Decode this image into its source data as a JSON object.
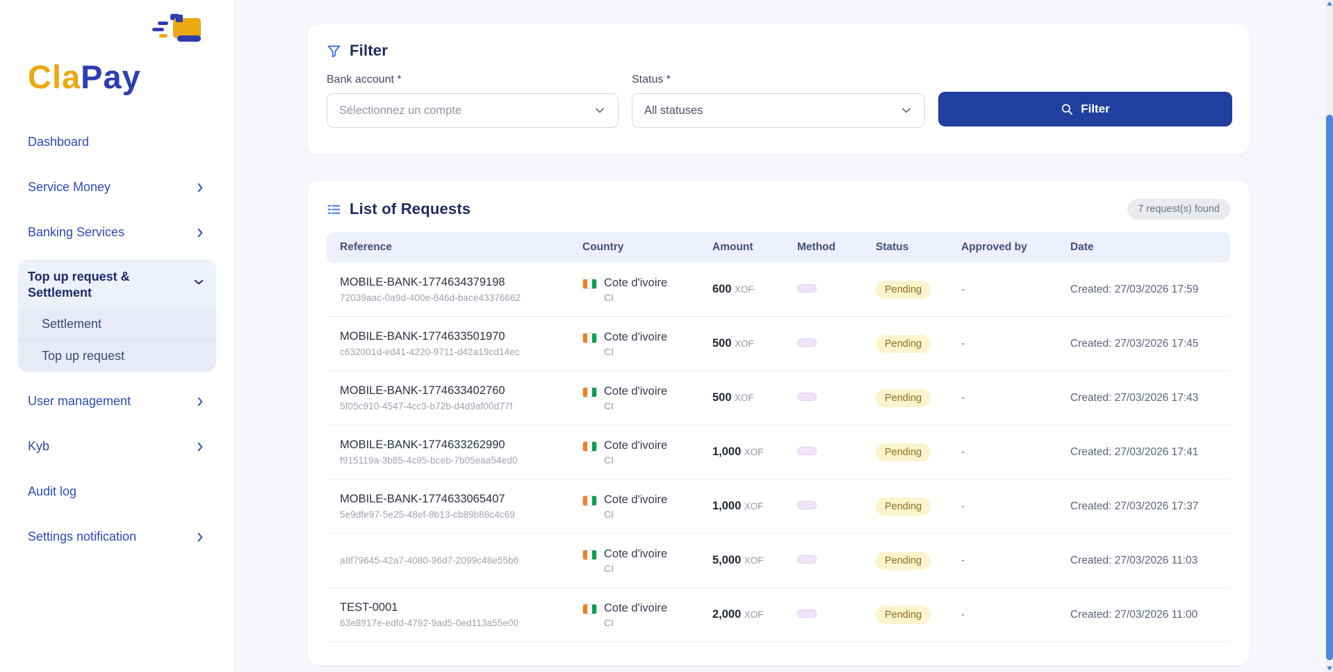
{
  "brand": {
    "name_prefix": "Cla",
    "name_suffix": "Pay",
    "colors": {
      "gold": "#e9a912",
      "blue": "#2d3eb2"
    }
  },
  "sidebar": {
    "items": [
      {
        "label": "Dashboard",
        "chevron": "none"
      },
      {
        "label": "Service Money",
        "chevron": "right"
      },
      {
        "label": "Banking Services",
        "chevron": "right"
      },
      {
        "label": "Top up request & Settlement",
        "chevron": "down",
        "expanded": true,
        "children": [
          {
            "label": "Settlement"
          },
          {
            "label": "Top up request"
          }
        ]
      },
      {
        "label": "User management",
        "chevron": "right"
      },
      {
        "label": "Kyb",
        "chevron": "right"
      },
      {
        "label": "Audit log",
        "chevron": "none"
      },
      {
        "label": "Settings notification",
        "chevron": "right"
      }
    ]
  },
  "filter": {
    "title": "Filter",
    "fields": [
      {
        "label": "Bank account *",
        "value": "",
        "placeholder": "Sélectionnez un compte"
      },
      {
        "label": "Status *",
        "value": "All statuses"
      }
    ],
    "button_label": "Filter",
    "button_color": "#203f9e"
  },
  "list": {
    "title": "List of Requests",
    "count_badge": "7 request(s) found",
    "columns": [
      "Reference",
      "Country",
      "Amount",
      "Method",
      "Status",
      "Approved by",
      "Date"
    ],
    "status_colors": {
      "pending_bg": "#fcf4cd",
      "pending_text": "#8c701f"
    },
    "rows": [
      {
        "reference": "MOBILE-BANK-1774634379198",
        "reference_sub": "72039aac-0a9d-400e-846d-bace43376662",
        "country": "Cote d'ivoire",
        "country_code": "CI",
        "amount": "600",
        "currency": "XOF",
        "status": "Pending",
        "approved_by": "-",
        "date": "Created: 27/03/2026 17:59"
      },
      {
        "reference": "MOBILE-BANK-1774633501970",
        "reference_sub": "c632001d-ed41-4220-9711-d42a19cd14ec",
        "country": "Cote d'ivoire",
        "country_code": "CI",
        "amount": "500",
        "currency": "XOF",
        "status": "Pending",
        "approved_by": "-",
        "date": "Created: 27/03/2026 17:45"
      },
      {
        "reference": "MOBILE-BANK-1774633402760",
        "reference_sub": "5f05c910-4547-4cc3-b72b-d4d9af00d77f",
        "country": "Cote d'ivoire",
        "country_code": "CI",
        "amount": "500",
        "currency": "XOF",
        "status": "Pending",
        "approved_by": "-",
        "date": "Created: 27/03/2026 17:43"
      },
      {
        "reference": "MOBILE-BANK-1774633262990",
        "reference_sub": "f915119a-3b85-4c95-bceb-7b05eaa54ed0",
        "country": "Cote d'ivoire",
        "country_code": "CI",
        "amount": "1,000",
        "currency": "XOF",
        "status": "Pending",
        "approved_by": "-",
        "date": "Created: 27/03/2026 17:41"
      },
      {
        "reference": "MOBILE-BANK-1774633065407",
        "reference_sub": "5e9dfe97-5e25-48ef-8b13-cb89b88c4c69",
        "country": "Cote d'ivoire",
        "country_code": "CI",
        "amount": "1,000",
        "currency": "XOF",
        "status": "Pending",
        "approved_by": "-",
        "date": "Created: 27/03/2026 17:37"
      },
      {
        "reference": "",
        "reference_sub": "a8f79645-42a7-4080-96d7-2099c48e55b6",
        "country": "Cote d'ivoire",
        "country_code": "CI",
        "amount": "5,000",
        "currency": "XOF",
        "status": "Pending",
        "approved_by": "-",
        "date": "Created: 27/03/2026 11:03"
      },
      {
        "reference": "TEST-0001",
        "reference_sub": "63e8917e-edfd-4792-9ad5-0ed113a55e00",
        "country": "Cote d'ivoire",
        "country_code": "CI",
        "amount": "2,000",
        "currency": "XOF",
        "status": "Pending",
        "approved_by": "-",
        "date": "Created: 27/03/2026 11:00"
      }
    ]
  }
}
